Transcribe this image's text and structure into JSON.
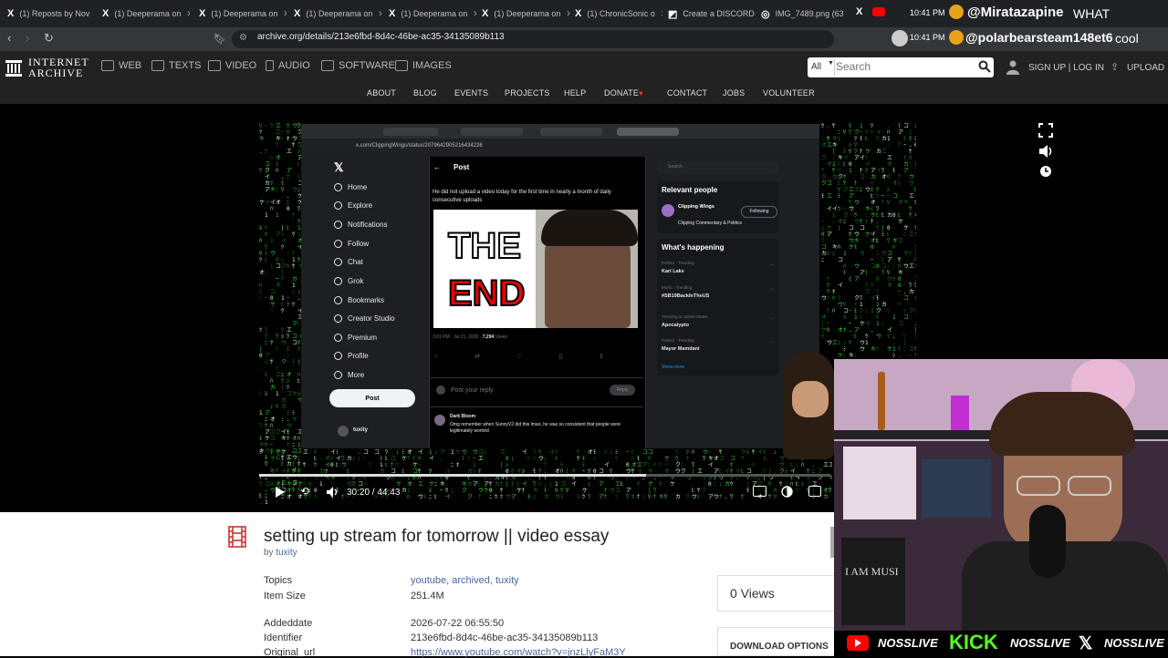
{
  "browser": {
    "tabs": [
      {
        "icon": "X",
        "label": "(1) Reposts by Nov"
      },
      {
        "icon": "X",
        "label": "(1) Deeperama on"
      },
      {
        "icon": "X",
        "label": "(1) Deeperama on"
      },
      {
        "icon": "X",
        "label": "(1) Deeperama on"
      },
      {
        "icon": "X",
        "label": "(1) Deeperama on"
      },
      {
        "icon": "X",
        "label": "(1) Deeperama on"
      },
      {
        "icon": "X",
        "label": "(1) ChronicSonic o"
      },
      {
        "icon": "◩",
        "label": "Create a DISCORD"
      },
      {
        "icon": "◎",
        "label": "IMG_7489.png (63"
      }
    ],
    "url": "archive.org/details/213e6fbd-8d4c-46be-ac35-34135089b113"
  },
  "overlay": {
    "time1": "10:41 PM",
    "time2": "10:41 PM",
    "chat1_user": "@Miratazapine",
    "chat1_msg": "WHAT",
    "chat2_user": "@polarbearsteam148et6",
    "chat2_msg": "cool",
    "bar": [
      "NOSSLIVE",
      "NOSSLIVE",
      "NOSSLIVE"
    ],
    "kick": "KICK",
    "mic_label": "I AM MUSI"
  },
  "ia": {
    "logo_line1": "INTERNET",
    "logo_line2": "ARCHIVE",
    "media": [
      "WEB",
      "TEXTS",
      "VIDEO",
      "AUDIO",
      "SOFTWARE",
      "IMAGES"
    ],
    "search_scope": "All",
    "search_placeholder": "Search",
    "signup": "SIGN UP | LOG IN",
    "upload": "UPLOAD",
    "nav": [
      "ABOUT",
      "BLOG",
      "EVENTS",
      "PROJECTS",
      "HELP",
      "DONATE",
      "CONTACT",
      "JOBS",
      "VOLUNTEER"
    ]
  },
  "video": {
    "time": "30:20 / 44:43",
    "progress": 0.678,
    "x_nav": [
      "Home",
      "Explore",
      "Notifications",
      "Follow",
      "Chat",
      "Grok",
      "Bookmarks",
      "Creator Studio",
      "Premium",
      "Profile",
      "More"
    ],
    "x_post_button": "Post",
    "x_header": "Post",
    "x_text": "He did not upload a video today for the first time in nearly a month of daily consecutive uploads",
    "thumb_line1": "THE",
    "thumb_line2": "END",
    "x_date": "3:01 PM · Jul 21, 2026 ·",
    "x_views": "7,294",
    "x_views_label": "Views",
    "x_reply_placeholder": "Post your reply",
    "x_reply_btn": "Reply",
    "x_reply_user": "Dark Bloom",
    "x_reply_text": "Omg remember when SunnyV2 did this lmao, he was so consistent that people were legitimately worried",
    "x_user": "tuxity",
    "x_search": "Search",
    "relevant_title": "Relevant people",
    "relevant_name": "Clipping Wings",
    "relevant_desc": "Clipping Commentary & Politics",
    "following": "Following",
    "happening_title": "What's happening",
    "trends": [
      {
        "cat": "Politics · Trending",
        "name": "Kari Lake"
      },
      {
        "cat": "Music · Trending",
        "name": "#SB19BackInTheUS"
      },
      {
        "cat": "Trending in United States",
        "name": "Apocalypto"
      },
      {
        "cat": "Politics · Trending",
        "name": "Mayor Mamdani"
      }
    ],
    "show_more": "Show more",
    "inner_url": "x.com/ClippingWings/status/2079642905216434226"
  },
  "item": {
    "title": "setting up stream for tomorrow || video essay",
    "by": "by",
    "author": "tuxity",
    "topics_label": "Topics",
    "topics": "youtube, archived, tuxity",
    "size_label": "Item Size",
    "size": "251.4M",
    "added_label": "Addeddate",
    "added": "2026-07-22 06:55:50",
    "id_label": "Identifier",
    "id": "213e6fbd-8d4c-46be-ac35-34135089b113",
    "orig_label": "Original_url",
    "orig": "https://www.youtube.com/watch?v=jnzLlyFaM3Y",
    "views": "0 Views",
    "download": "DOWNLOAD OPTIONS"
  }
}
